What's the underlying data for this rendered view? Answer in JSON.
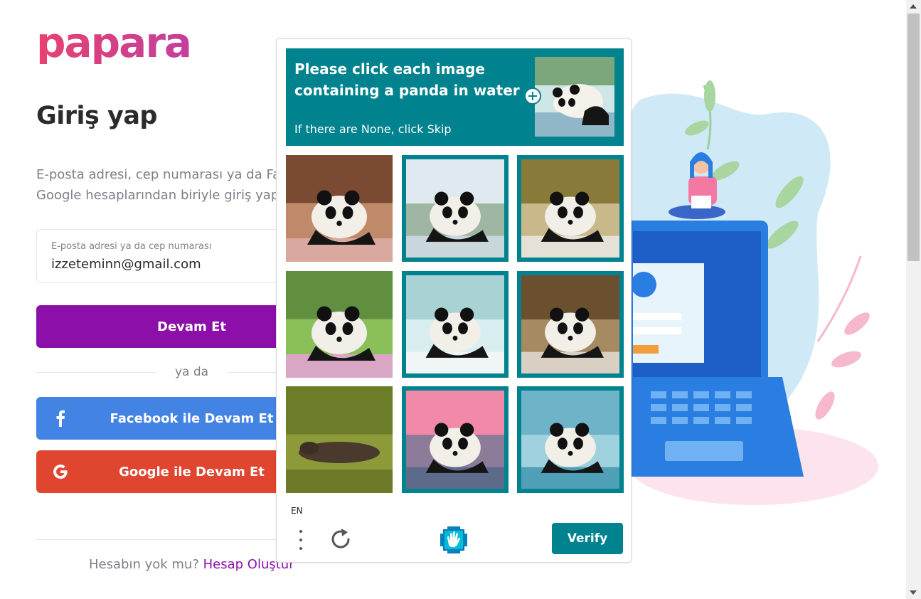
{
  "brand": {
    "logo_text": "papara",
    "primary": "#8b0fa8",
    "facebook": "#4283e3",
    "google": "#e0452f",
    "captcha_accent": "#00838f"
  },
  "login": {
    "title": "Giriş yap",
    "intro_line1": "E-posta adresi, cep numarası ya da Fa",
    "intro_line2": "Google hesaplarından biriyle giriş yap",
    "email_label": "E-posta adresi ya da cep numarası",
    "email_value": "izzeteminn@gmail.com",
    "continue_label": "Devam Et",
    "or_text": "ya da",
    "facebook_label": "Facebook ile Devam Et",
    "facebook_icon": "facebook-icon",
    "google_label": "Google ile Devam Et",
    "google_icon": "google-icon",
    "signup_prompt": "Hesabın yok mu?",
    "signup_link": "Hesap Oluştur"
  },
  "captcha": {
    "prompt": "Please click each image containing a panda in water",
    "sub": "If there are None, click Skip",
    "lang": "EN",
    "verify_label": "Verify",
    "tiles": [
      {
        "desc": "panda on cushion",
        "selected": false
      },
      {
        "desc": "panda in water at sunset",
        "selected": true
      },
      {
        "desc": "panda in water",
        "selected": true
      },
      {
        "desc": "panda in flowers",
        "selected": false
      },
      {
        "desc": "panda splashing in water",
        "selected": true
      },
      {
        "desc": "panda in water",
        "selected": true
      },
      {
        "desc": "otter on grass",
        "selected": false
      },
      {
        "desc": "panda in pink water",
        "selected": true
      },
      {
        "desc": "panda swimming",
        "selected": true
      }
    ]
  }
}
